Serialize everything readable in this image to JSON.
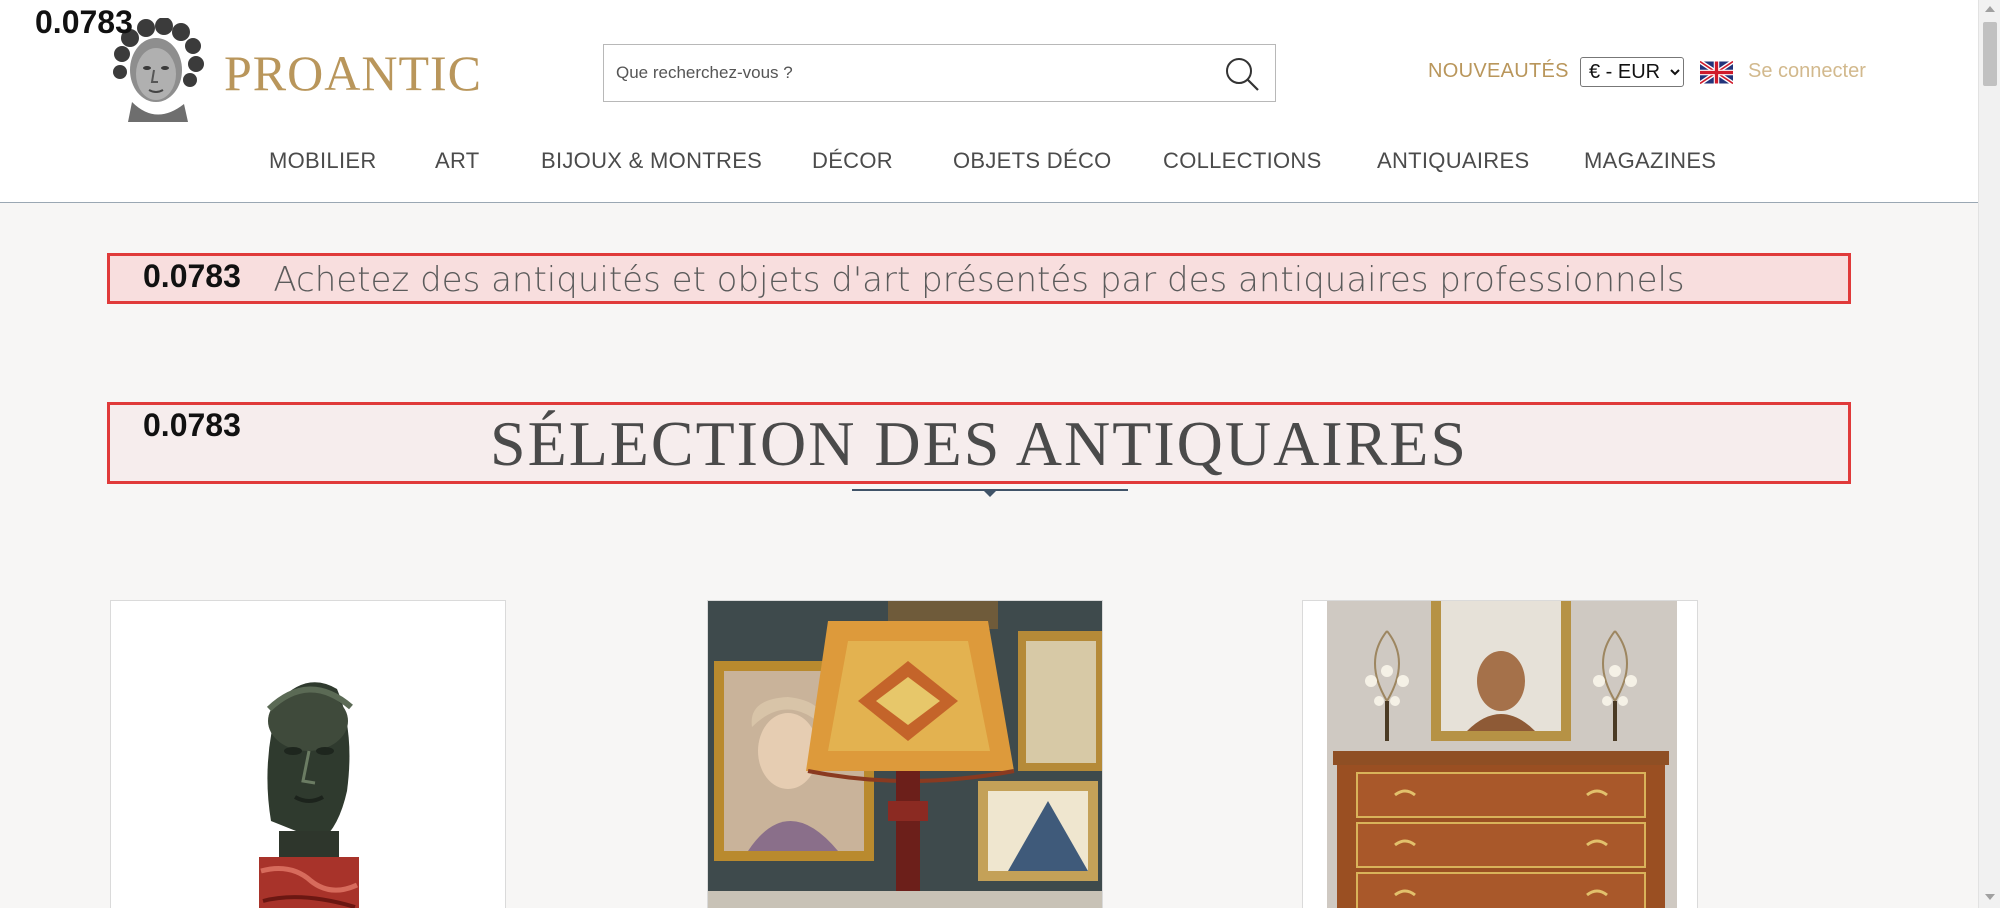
{
  "header": {
    "logo_text": "PROANTIC",
    "logo_icon": "sculpted-head-logo-icon",
    "search": {
      "placeholder": "Que recherchez-vous ?",
      "value": "",
      "icon": "search-icon"
    },
    "nouveautes_label": "NOUVEAUTÉS",
    "currency": {
      "selected": "€ - EUR",
      "options": [
        "€ - EUR"
      ]
    },
    "language_flag_icon": "uk-flag-icon",
    "login_label": "Se connecter",
    "accent_color": "#b9965b"
  },
  "nav": {
    "items": [
      {
        "label": "MOBILIER"
      },
      {
        "label": "ART"
      },
      {
        "label": "BIJOUX & MONTRES"
      },
      {
        "label": "DÉCOR"
      },
      {
        "label": "OBJETS DÉCO"
      },
      {
        "label": "COLLECTIONS"
      },
      {
        "label": "ANTIQUAIRES"
      },
      {
        "label": "MAGAZINES"
      }
    ]
  },
  "badges": {
    "logo_badge": "0.0783",
    "tagline_badge": "0.0783",
    "selection_badge": "0.0783"
  },
  "main": {
    "tagline": "Achetez des antiquités et objets d'art présentés par des antiquaires professionnels",
    "selection_title": "SÉLECTION DES ANTIQUAIRES",
    "highlight_border_color": "#e03a3a"
  },
  "products": [
    {
      "image": "bronze-head-bust-on-marble-base"
    },
    {
      "image": "painted-lamp-and-framed-portrait-paintings"
    },
    {
      "image": "louis-xvi-commode-with-mirror-and-candelabra"
    }
  ]
}
